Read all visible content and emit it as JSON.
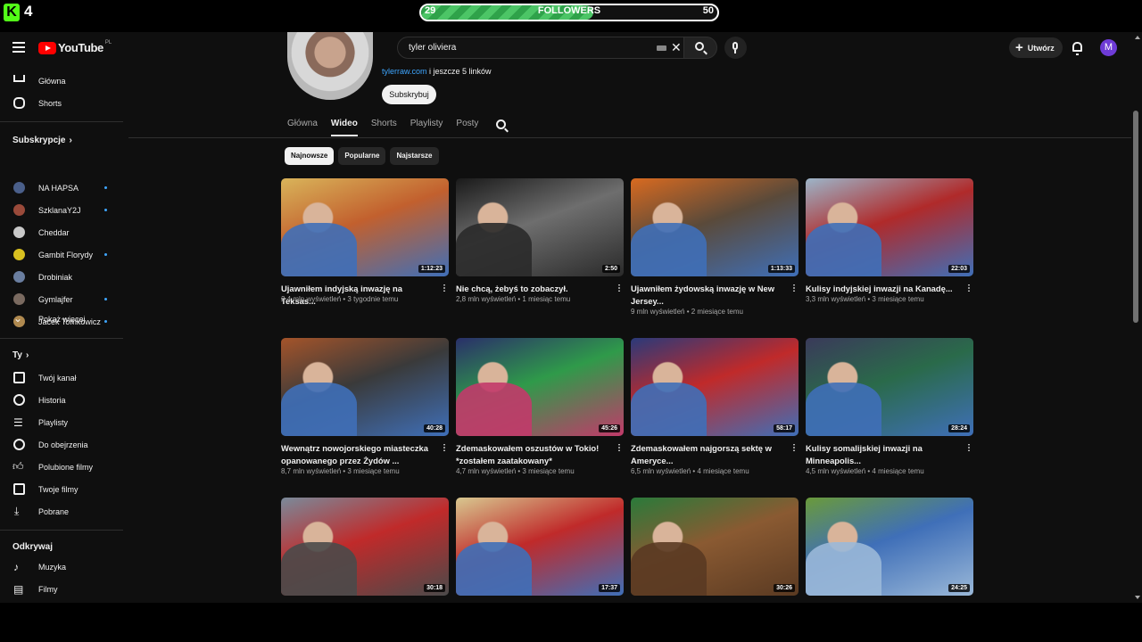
{
  "overlay": {
    "logo": "K",
    "viewer_count": "4",
    "goal_current": "29",
    "goal_label": "FOLLOWERS",
    "goal_target": "50",
    "goal_progress": 0.58
  },
  "header": {
    "logo_text": "YouTube",
    "region": "PL",
    "search_value": "tyler oliviera",
    "create_label": "Utwórz",
    "avatar_letter": "M"
  },
  "sidebar": {
    "main": [
      {
        "label": "Główna",
        "icon": "home-icon"
      },
      {
        "label": "Shorts",
        "icon": "shorts-icon"
      }
    ],
    "subscriptions_title": "Subskrypcje",
    "subscriptions": [
      {
        "label": "NA HAPSA",
        "color": "#4a5f8a",
        "new": true
      },
      {
        "label": "SzklanaY2J",
        "color": "#9a4a3a",
        "new": true
      },
      {
        "label": "Cheddar",
        "color": "#c9c9c9",
        "new": false
      },
      {
        "label": "Gambit Florydy",
        "color": "#d8c020",
        "new": true
      },
      {
        "label": "Drobiniak",
        "color": "#6a7ea0",
        "new": false
      },
      {
        "label": "Gymlajfer",
        "color": "#7a6a60",
        "new": true
      },
      {
        "label": "Jacek Tomkowicz",
        "color": "#b08a50",
        "new": true
      }
    ],
    "show_more": "Pokaż więcej",
    "you_title": "Ty",
    "you": [
      {
        "label": "Twój kanał",
        "icon": "channel-icon"
      },
      {
        "label": "Historia",
        "icon": "history-icon"
      },
      {
        "label": "Playlisty",
        "icon": "playlist-icon"
      },
      {
        "label": "Do obejrzenia",
        "icon": "clock-icon"
      },
      {
        "label": "Polubione filmy",
        "icon": "thumbs-up-icon"
      },
      {
        "label": "Twoje filmy",
        "icon": "video-icon"
      },
      {
        "label": "Pobrane",
        "icon": "download-icon"
      }
    ],
    "explore_title": "Odkrywaj",
    "explore": [
      {
        "label": "Muzyka",
        "icon": "music-icon"
      },
      {
        "label": "Filmy",
        "icon": "film-icon"
      }
    ]
  },
  "channel": {
    "link_text": "tylerraw.com",
    "link_suffix": " i jeszcze 5 linków",
    "subscribe_label": "Subskrybuj",
    "tabs": [
      "Główna",
      "Wideo",
      "Shorts",
      "Playlisty",
      "Posty"
    ],
    "active_tab": "Wideo",
    "chips": [
      "Najnowsze",
      "Popularne",
      "Najstarsze"
    ]
  },
  "videos": [
    {
      "title": "Ujawniłem indyjską inwazję na Teksas...",
      "views": "2,4 mln wyświetleń",
      "age": "3 tygodnie temu",
      "duration": "1:12:23",
      "colors": [
        "#3f6fb8",
        "#c2602e",
        "#d9b45a"
      ]
    },
    {
      "title": "Nie chcą, żebyś to zobaczył.",
      "views": "2,8 mln wyświetleń",
      "age": "1 miesiąc temu",
      "duration": "2:50",
      "colors": [
        "#2a2a2a",
        "#6e6e6e",
        "#1a1a1a"
      ]
    },
    {
      "title": "Ujawniłem żydowską inwazję w New Jersey...",
      "views": "9 mln wyświetleń",
      "age": "2 miesiące temu",
      "duration": "1:13:33",
      "colors": [
        "#3f6fb8",
        "#5a4a3a",
        "#d86a20"
      ]
    },
    {
      "title": "Kulisy indyjskiej inwazji na Kanadę...",
      "views": "3,3 mln wyświetleń",
      "age": "3 miesiące temu",
      "duration": "22:03",
      "colors": [
        "#3f6fb8",
        "#b02a2a",
        "#9cb5c9"
      ]
    },
    {
      "title": "Wewnątrz nowojorskiego miasteczka opanowanego przez Żydów ...",
      "views": "8,7 mln wyświetleń",
      "age": "3 miesiące temu",
      "duration": "40:28",
      "colors": [
        "#3f6fb8",
        "#3a3a3a",
        "#a4542a"
      ]
    },
    {
      "title": "Zdemaskowałem oszustów w Tokio! *zostałem zaatakowany*",
      "views": "4,7 mln wyświetleń",
      "age": "3 miesiące temu",
      "duration": "45:26",
      "colors": [
        "#c23a6a",
        "#2f9a4a",
        "#2a2f6a"
      ]
    },
    {
      "title": "Zdemaskowałem najgorszą sektę w Ameryce...",
      "views": "6,5 mln wyświetleń",
      "age": "4 miesiące temu",
      "duration": "58:17",
      "colors": [
        "#3f6fb8",
        "#c02a2a",
        "#2a3a7a"
      ]
    },
    {
      "title": "Kulisy somalijskiej inwazji na Minneapolis...",
      "views": "4,5 mln wyświetleń",
      "age": "4 miesiące temu",
      "duration": "28:24",
      "colors": [
        "#3f6fb8",
        "#2a6a4a",
        "#3a3a5a"
      ]
    },
    {
      "title": "",
      "views": "",
      "age": "",
      "duration": "30:18",
      "colors": [
        "#4a4a4a",
        "#c02a2a",
        "#7a8a9a"
      ]
    },
    {
      "title": "",
      "views": "",
      "age": "",
      "duration": "17:37",
      "colors": [
        "#3f6fb8",
        "#c02a2a",
        "#d8c890"
      ]
    },
    {
      "title": "",
      "views": "",
      "age": "",
      "duration": "30:26",
      "colors": [
        "#5a3a22",
        "#8a5a32",
        "#2a7a3a"
      ]
    },
    {
      "title": "",
      "views": "",
      "age": "",
      "duration": "24:25",
      "colors": [
        "#9ab8d8",
        "#3f6fb8",
        "#6a9a3a"
      ]
    }
  ]
}
